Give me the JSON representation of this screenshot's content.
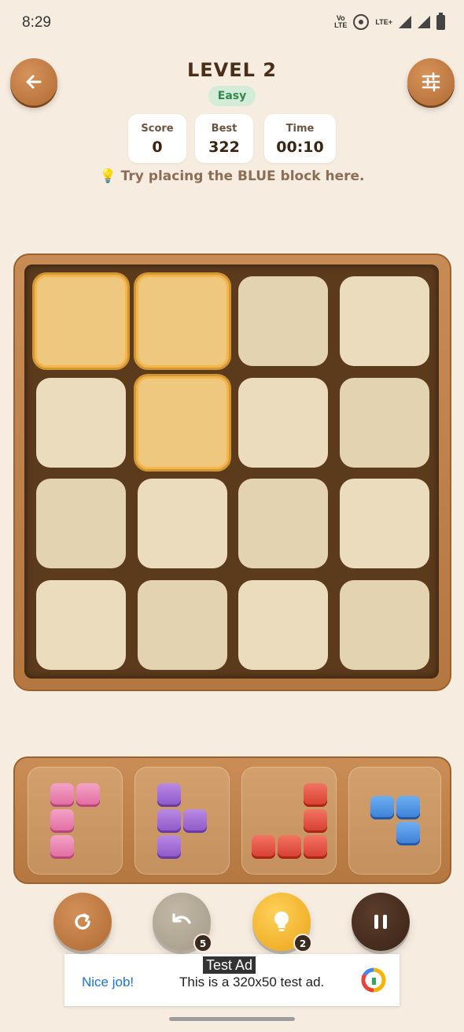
{
  "status_bar": {
    "time": "8:29",
    "volte_label": "Vo¹\nLTE",
    "network_label": "LTE+"
  },
  "header": {
    "title": "LEVEL 2",
    "difficulty": "Easy"
  },
  "stats": [
    {
      "label": "Score",
      "value": "0"
    },
    {
      "label": "Best",
      "value": "322"
    },
    {
      "label": "Time",
      "value": "00:10"
    }
  ],
  "hint_text": "Try placing the BLUE block here.",
  "board": {
    "rows": 4,
    "cols": 4,
    "highlighted_cells": [
      [
        0,
        0
      ],
      [
        0,
        1
      ],
      [
        1,
        1
      ]
    ]
  },
  "pieces": [
    {
      "color": "pink",
      "cells": [
        [
          0,
          0
        ],
        [
          0,
          1
        ],
        [
          1,
          0
        ],
        [
          2,
          0
        ]
      ]
    },
    {
      "color": "purple",
      "cells": [
        [
          0,
          0
        ],
        [
          1,
          0
        ],
        [
          1,
          1
        ],
        [
          2,
          0
        ]
      ]
    },
    {
      "color": "red",
      "cells": [
        [
          0,
          2
        ],
        [
          1,
          2
        ],
        [
          2,
          0
        ],
        [
          2,
          1
        ],
        [
          2,
          2
        ]
      ]
    },
    {
      "color": "blue",
      "cells": [
        [
          0,
          0
        ],
        [
          0,
          1
        ],
        [
          1,
          1
        ]
      ]
    }
  ],
  "controls": {
    "undo_count": "5",
    "hint_count": "2"
  },
  "ad": {
    "tag": "Test Ad",
    "headline": "Nice job!",
    "body": "This is a 320x50 test ad."
  },
  "colors": {
    "background": "#f6ece0",
    "accent_brown": "#b06a33",
    "highlight": "#eec87f",
    "easy_green": "#2f8a4c"
  },
  "icons": [
    "back-arrow-icon",
    "sliders-icon",
    "bulb-icon",
    "restart-icon",
    "undo-icon",
    "hint-bulb-icon",
    "pause-icon"
  ]
}
